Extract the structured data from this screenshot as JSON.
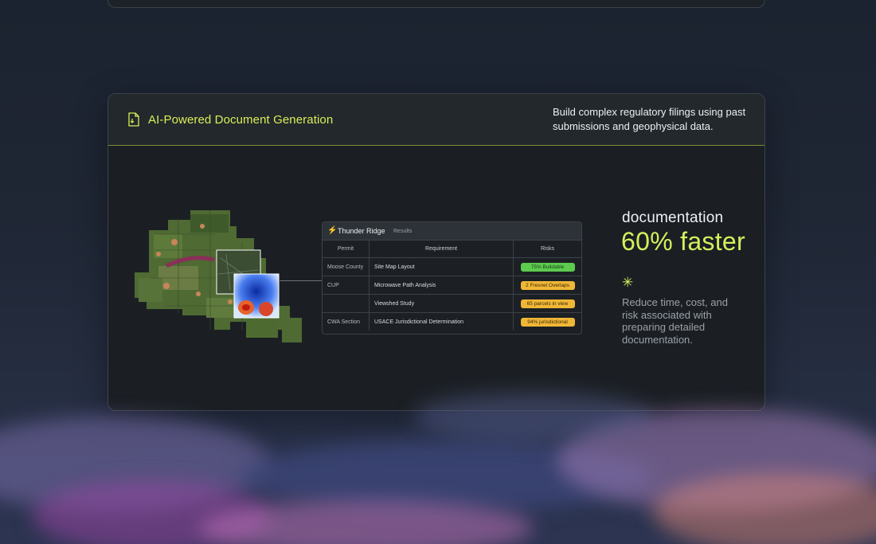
{
  "feature": {
    "title": "AI-Powered Document Generation",
    "description": "Build complex regulatory filings using past submissions and geophysical data.",
    "icon": "document-icon"
  },
  "results": {
    "title": "Thunder Ridge",
    "subtitle": "Results",
    "icon": "lightning-icon",
    "columns": [
      "Permit",
      "Requirement",
      "Risks"
    ],
    "rows": [
      {
        "permit": "Moose County",
        "requirement": "Site Map Layout",
        "risk": "75% Buildable",
        "risk_color": "#5ccb4e"
      },
      {
        "permit": "CUP",
        "requirement": "Microwave Path Analysis",
        "risk": "2 Fresnel Overlaps",
        "risk_color": "#f0b736"
      },
      {
        "permit": "",
        "requirement": "Viewshed Study",
        "risk": "65 parcels in view",
        "risk_color": "#f0b736"
      },
      {
        "permit": "CWA Section",
        "requirement": "USACE Jurisdictional Determination",
        "risk": "94% jurisdictional",
        "risk_color": "#f0b736"
      }
    ]
  },
  "stat": {
    "label": "documentation",
    "value": "60% faster",
    "icon": "sparkle-icon",
    "description": "Reduce time, cost, and risk associated with preparing detailed documentation."
  },
  "colors": {
    "accent": "#d6ef5c",
    "card_bg": "#1b1f24",
    "header_bg": "#22282b"
  }
}
